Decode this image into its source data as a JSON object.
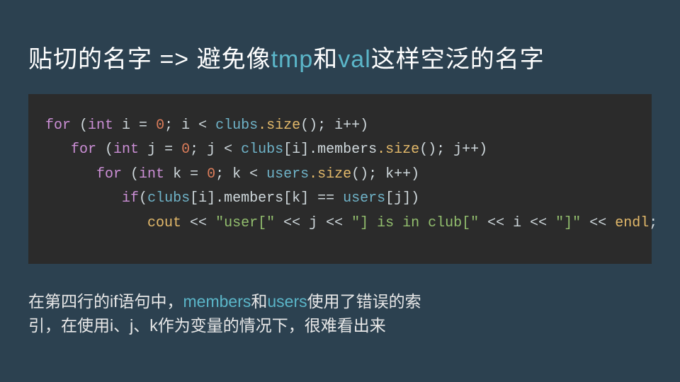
{
  "title": {
    "p1": "贴切的名字 => 避免像",
    "a1": "tmp",
    "p2": "和",
    "a2": "val",
    "p3": "这样空泛的名字"
  },
  "code": {
    "l1": {
      "kw1": "for ",
      "op1": "(",
      "kw2": "int ",
      "var": "i = ",
      "num": "0",
      "op2": "; i < ",
      "obj": "clubs",
      "fn": ".size",
      "tail": "(); i++)"
    },
    "l2": {
      "kw1": "for ",
      "op1": "(",
      "kw2": "int ",
      "var": "j = ",
      "num": "0",
      "op2": "; j < ",
      "obj": "clubs",
      "mid": "[i].members",
      "fn": ".size",
      "tail": "(); j++)"
    },
    "l3": {
      "kw1": "for ",
      "op1": "(",
      "kw2": "int ",
      "var": "k = ",
      "num": "0",
      "op2": "; k < ",
      "obj": "users",
      "fn": ".size",
      "tail": "(); k++)"
    },
    "l4": {
      "kw1": "if",
      "op1": "(",
      "obj1": "clubs",
      "mid1": "[i].members[k] == ",
      "obj2": "users",
      "tail": "[j])"
    },
    "l5": {
      "fn1": "cout",
      "op1": " << ",
      "s1": "\"user[\"",
      "op2": " << j << ",
      "s2": "\"] is in club[\"",
      "op3": " << i << ",
      "s3": "\"]\"",
      "op4": " << ",
      "fn2": "endl",
      "tail": ";"
    }
  },
  "caption": {
    "p1": "在第四行的if语句中，",
    "a1": "members",
    "p2": "和",
    "a2": "users",
    "p3": "使用了错误的索",
    "p4": "引，在使用i、j、k作为变量的情况下，很难看出来"
  }
}
